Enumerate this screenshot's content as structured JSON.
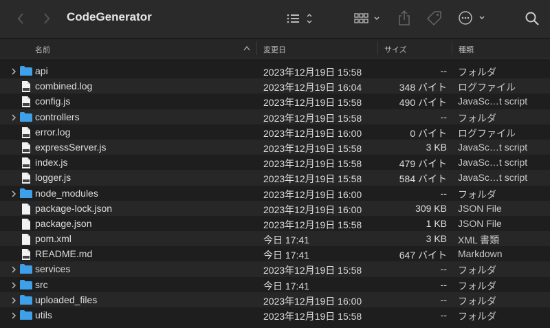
{
  "window": {
    "title": "CodeGenerator"
  },
  "toolbar": {
    "back_icon": "chevron-left-icon",
    "forward_icon": "chevron-right-icon",
    "list_icon": "list-view-icon",
    "grid_icon": "grid-view-icon",
    "share_icon": "share-icon",
    "tag_icon": "tag-icon",
    "more_icon": "ellipsis-circle-icon",
    "search_icon": "search-icon"
  },
  "columns": {
    "name": "名前",
    "date": "変更日",
    "size": "サイズ",
    "kind": "種類"
  },
  "files": [
    {
      "name": "api",
      "type": "folder",
      "date": "2023年12月19日 15:58",
      "size": "--",
      "kind": "フォルダ"
    },
    {
      "name": "combined.log",
      "type": "log",
      "date": "2023年12月19日 16:04",
      "size": "348 バイト",
      "kind": "ログファイル"
    },
    {
      "name": "config.js",
      "type": "js",
      "date": "2023年12月19日 15:58",
      "size": "490 バイト",
      "kind": "JavaSc…t script"
    },
    {
      "name": "controllers",
      "type": "folder",
      "date": "2023年12月19日 15:58",
      "size": "--",
      "kind": "フォルダ"
    },
    {
      "name": "error.log",
      "type": "log",
      "date": "2023年12月19日 16:00",
      "size": "0 バイト",
      "kind": "ログファイル"
    },
    {
      "name": "expressServer.js",
      "type": "js",
      "date": "2023年12月19日 15:58",
      "size": "3 KB",
      "kind": "JavaSc…t script"
    },
    {
      "name": "index.js",
      "type": "js",
      "date": "2023年12月19日 15:58",
      "size": "479 バイト",
      "kind": "JavaSc…t script"
    },
    {
      "name": "logger.js",
      "type": "js",
      "date": "2023年12月19日 15:58",
      "size": "584 バイト",
      "kind": "JavaSc…t script"
    },
    {
      "name": "node_modules",
      "type": "folder",
      "date": "2023年12月19日 16:00",
      "size": "--",
      "kind": "フォルダ"
    },
    {
      "name": "package-lock.json",
      "type": "doc",
      "date": "2023年12月19日 16:00",
      "size": "309 KB",
      "kind": "JSON File"
    },
    {
      "name": "package.json",
      "type": "doc",
      "date": "2023年12月19日 15:58",
      "size": "1 KB",
      "kind": "JSON File"
    },
    {
      "name": "pom.xml",
      "type": "doc",
      "date": "今日 17:41",
      "size": "3 KB",
      "kind": "XML 書類"
    },
    {
      "name": "README.md",
      "type": "md",
      "date": "今日 17:41",
      "size": "647 バイト",
      "kind": "Markdown"
    },
    {
      "name": "services",
      "type": "folder",
      "date": "2023年12月19日 15:58",
      "size": "--",
      "kind": "フォルダ"
    },
    {
      "name": "src",
      "type": "folder",
      "date": "今日 17:41",
      "size": "--",
      "kind": "フォルダ"
    },
    {
      "name": "uploaded_files",
      "type": "folder",
      "date": "2023年12月19日 16:00",
      "size": "--",
      "kind": "フォルダ"
    },
    {
      "name": "utils",
      "type": "folder",
      "date": "2023年12月19日 15:58",
      "size": "--",
      "kind": "フォルダ"
    }
  ],
  "colors": {
    "folder": "#3ea0e8",
    "background": "#1e1e1e",
    "toolbar": "#2a2a2a"
  }
}
